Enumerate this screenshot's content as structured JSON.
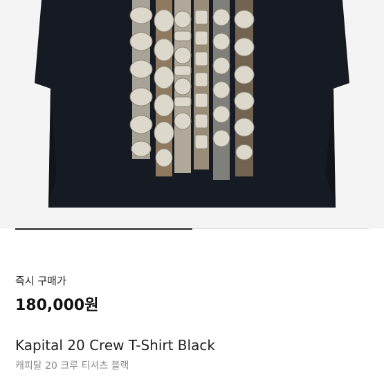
{
  "product": {
    "image_alt": "product-photo",
    "image_progress": 0.5,
    "price_label": "즉시 구매가",
    "price": "180,000원",
    "title": "Kapital 20 Crew T-Shirt Black",
    "subtitle": "캐피탈 20 크루 티셔츠 블랙"
  },
  "colors": {
    "shirt": "#161a22",
    "indicator": "#222222",
    "subtitle": "#8a8a8a"
  }
}
